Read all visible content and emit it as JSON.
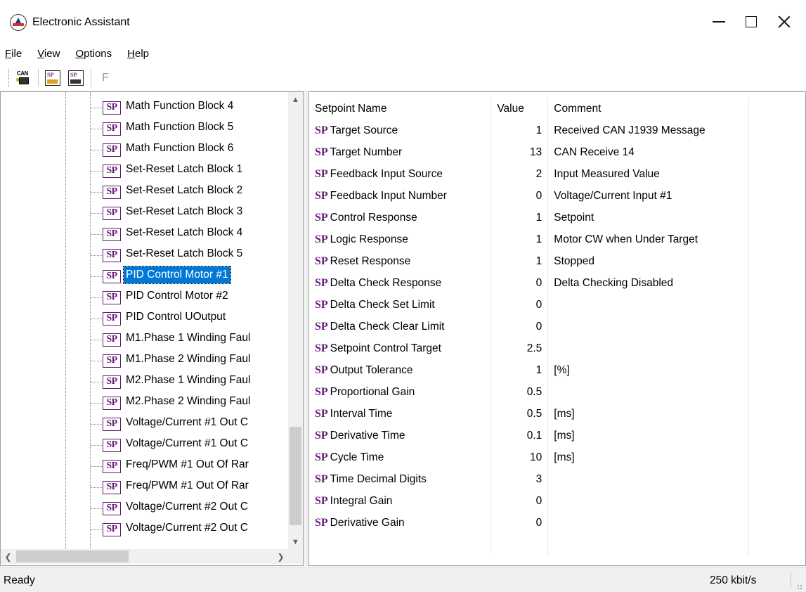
{
  "window": {
    "title": "Electronic Assistant"
  },
  "menu": {
    "items": [
      {
        "accel": "F",
        "rest": "ile"
      },
      {
        "accel": "V",
        "rest": "iew"
      },
      {
        "accel": "O",
        "rest": "ptions"
      },
      {
        "accel": "H",
        "rest": "elp"
      }
    ]
  },
  "toolbar": {
    "can_label": "CAN",
    "sp_label": "SP",
    "f_label": "F"
  },
  "tree": {
    "badge": "SP",
    "items": [
      {
        "label": "Math Function Block 4",
        "selected": false
      },
      {
        "label": "Math Function Block 5",
        "selected": false
      },
      {
        "label": "Math Function Block 6",
        "selected": false
      },
      {
        "label": "Set-Reset Latch Block 1",
        "selected": false
      },
      {
        "label": "Set-Reset Latch Block 2",
        "selected": false
      },
      {
        "label": "Set-Reset Latch Block 3",
        "selected": false
      },
      {
        "label": "Set-Reset Latch Block 4",
        "selected": false
      },
      {
        "label": "Set-Reset Latch Block 5",
        "selected": false
      },
      {
        "label": "PID Control Motor #1",
        "selected": true
      },
      {
        "label": "PID Control Motor #2",
        "selected": false
      },
      {
        "label": "PID Control UOutput",
        "selected": false
      },
      {
        "label": "M1.Phase 1 Winding Faul",
        "selected": false
      },
      {
        "label": "M1.Phase 2 Winding Faul",
        "selected": false
      },
      {
        "label": "M2.Phase 1 Winding Faul",
        "selected": false
      },
      {
        "label": "M2.Phase 2 Winding Faul",
        "selected": false
      },
      {
        "label": "Voltage/Current #1 Out C",
        "selected": false
      },
      {
        "label": "Voltage/Current #1 Out C",
        "selected": false
      },
      {
        "label": "Freq/PWM #1 Out Of Rar",
        "selected": false
      },
      {
        "label": "Freq/PWM #1 Out Of Rar",
        "selected": false
      },
      {
        "label": "Voltage/Current #2 Out C",
        "selected": false
      },
      {
        "label": "Voltage/Current #2 Out C",
        "selected": false
      }
    ]
  },
  "table": {
    "prefix": "SP",
    "headers": {
      "name": "Setpoint Name",
      "value": "Value",
      "comment": "Comment"
    },
    "rows": [
      {
        "name": "Target Source",
        "value": "1",
        "comment": "Received CAN J1939 Message"
      },
      {
        "name": "Target Number",
        "value": "13",
        "comment": "CAN Receive 14"
      },
      {
        "name": "Feedback Input Source",
        "value": "2",
        "comment": "Input Measured Value"
      },
      {
        "name": "Feedback Input Number",
        "value": "0",
        "comment": "Voltage/Current Input #1"
      },
      {
        "name": "Control Response",
        "value": "1",
        "comment": "Setpoint"
      },
      {
        "name": "Logic Response",
        "value": "1",
        "comment": "Motor CW when Under Target"
      },
      {
        "name": "Reset Response",
        "value": "1",
        "comment": "Stopped"
      },
      {
        "name": "Delta Check Response",
        "value": "0",
        "comment": "Delta Checking Disabled"
      },
      {
        "name": "Delta Check Set Limit",
        "value": "0",
        "comment": ""
      },
      {
        "name": "Delta Check Clear Limit",
        "value": "0",
        "comment": ""
      },
      {
        "name": "Setpoint Control Target",
        "value": "2.5",
        "comment": ""
      },
      {
        "name": "Output Tolerance",
        "value": "1",
        "comment": "[%]"
      },
      {
        "name": "Proportional Gain",
        "value": "0.5",
        "comment": ""
      },
      {
        "name": "Interval Time",
        "value": "0.5",
        "comment": "[ms]"
      },
      {
        "name": "Derivative Time",
        "value": "0.1",
        "comment": "[ms]"
      },
      {
        "name": "Cycle Time",
        "value": "10",
        "comment": "[ms]"
      },
      {
        "name": "Time Decimal Digits",
        "value": "3",
        "comment": ""
      },
      {
        "name": "Integral Gain",
        "value": "0",
        "comment": ""
      },
      {
        "name": "Derivative Gain",
        "value": "0",
        "comment": ""
      }
    ]
  },
  "status": {
    "text": "Ready",
    "rate": "250 kbit/s"
  },
  "colors": {
    "selection": "#0078d7",
    "sp_badge": "#6a1b7a"
  }
}
